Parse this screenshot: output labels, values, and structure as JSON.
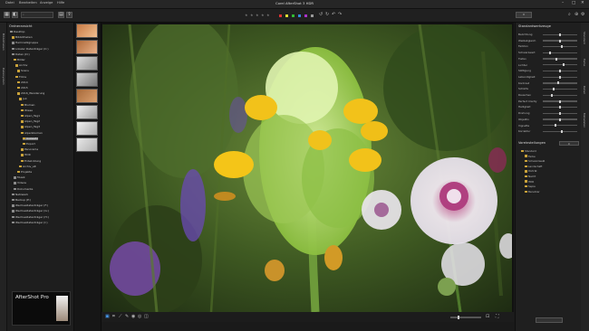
{
  "window": {
    "title": "Corel AfterShot 3 HDR",
    "menu": [
      "Datei",
      "Bearbeiten",
      "Anzeige",
      "Hilfe"
    ],
    "controls": [
      "–",
      "□",
      "✕"
    ]
  },
  "toolbar": {
    "search_placeholder": "",
    "color_labels": [
      "#d33",
      "#dd3",
      "#3b3",
      "#38d",
      "#a3c",
      "#999"
    ],
    "stars": [
      "★",
      "★",
      "★",
      "★",
      "★"
    ],
    "right_icons": [
      "search-icon",
      "zoom-icon",
      "gear-icon",
      "info-icon"
    ]
  },
  "left_tabs": [
    "Bibliotheken",
    "Dateisystem"
  ],
  "folder_panel": {
    "title": "Ordneransicht",
    "items": [
      {
        "label": "Desktop",
        "type": "d"
      },
      {
        "label": "Bibliotheken",
        "type": "f"
      },
      {
        "label": "Heimnetzgruppe",
        "type": "d"
      },
      {
        "label": "Lokaler Datenträger (C:)",
        "type": "d"
      },
      {
        "label": "Daten (D:)",
        "type": "d"
      },
      {
        "label": "Bilder",
        "type": "f"
      },
      {
        "label": "Archiv",
        "type": "f"
      },
      {
        "label": "Scans",
        "type": "f"
      },
      {
        "label": "Fotos",
        "type": "f"
      },
      {
        "label": "2014",
        "type": "f"
      },
      {
        "label": "2015",
        "type": "f"
      },
      {
        "label": "2016_Wanderung",
        "type": "f"
      },
      {
        "label": "Juli",
        "type": "f"
      },
      {
        "label": "Blumen",
        "type": "f"
      },
      {
        "label": "Wiese",
        "type": "f"
      },
      {
        "label": "Alpen_Tag1",
        "type": "f"
      },
      {
        "label": "Alpen_Tag2",
        "type": "f"
      },
      {
        "label": "Alpen_Tag3",
        "type": "f"
      },
      {
        "label": "Alpenblumen",
        "type": "f"
      },
      {
        "label": "Auswahl",
        "type": "f",
        "selected": true
      },
      {
        "label": "Export",
        "type": "f"
      },
      {
        "label": "Panorama",
        "type": "f"
      },
      {
        "label": "HDR",
        "type": "f"
      },
      {
        "label": "Entwicklung",
        "type": "f"
      },
      {
        "label": "Archiv_alt",
        "type": "f"
      },
      {
        "label": "Projekte",
        "type": "f"
      },
      {
        "label": "Musik",
        "type": "d"
      },
      {
        "label": "Videos",
        "type": "d"
      },
      {
        "label": "Dokumente",
        "type": "d"
      },
      {
        "label": "Netzwerk",
        "type": "d"
      },
      {
        "label": "Backup (E:)",
        "type": "d"
      },
      {
        "label": "Wechseldatenträger (F:)",
        "type": "d"
      },
      {
        "label": "Wechseldatenträger (G:)",
        "type": "d"
      },
      {
        "label": "Wechseldatenträger (H:)",
        "type": "d"
      },
      {
        "label": "Wechseldatenträger (I:)",
        "type": "d"
      }
    ]
  },
  "ad": {
    "title": "AfterShot Pro",
    "subtitle": "",
    "cta": ""
  },
  "adjust_panel": {
    "title": "Standardwerkzeuge",
    "rows": [
      {
        "label": "Belichtung",
        "value": 0.5
      },
      {
        "label": "Weißabgleich",
        "value": 0.5
      },
      {
        "label": "Farbton",
        "value": 0.55
      },
      {
        "label": "Schwarzwert",
        "value": 0.2
      },
      {
        "label": "Tiefen",
        "value": 0.4
      },
      {
        "label": "Lichter",
        "value": 0.6
      },
      {
        "label": "Sättigung",
        "value": 0.5
      },
      {
        "label": "Lebendigkeit",
        "value": 0.5
      },
      {
        "label": "Kontrast",
        "value": 0.45
      },
      {
        "label": "Schärfe",
        "value": 0.3
      },
      {
        "label": "Rauschen",
        "value": 0.25
      },
      {
        "label": "Perfect Clarity",
        "value": 0.5
      },
      {
        "label": "Helligkeit",
        "value": 0.5
      },
      {
        "label": "Drehung",
        "value": 0.5
      },
      {
        "label": "Objektiv",
        "value": 0.5
      },
      {
        "label": "Vignette",
        "value": 0.35
      },
      {
        "label": "Korrektur",
        "value": 0.55
      }
    ]
  },
  "output_panel": {
    "title": "Voreinstellungen",
    "items": [
      "Standard",
      "Farbe",
      "Schwarzweiß",
      "Landschaft",
      "Porträt",
      "Nacht",
      "HDR",
      "Sepia",
      "Benutzer"
    ]
  },
  "right_tabs": [
    "Standard",
    "Farbe",
    "Detail",
    "Metadaten"
  ],
  "viewbar": {
    "zoom": "",
    "page": ""
  }
}
